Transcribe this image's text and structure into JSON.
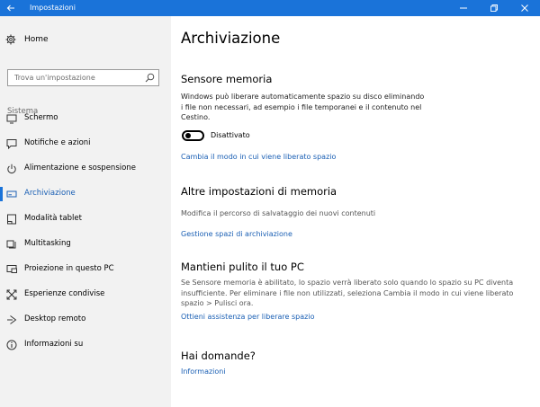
{
  "titlebar": {
    "title": "Impostazioni"
  },
  "sidebar": {
    "home_label": "Home",
    "search_placeholder": "Trova un'impostazione",
    "section_label": "Sistema",
    "items": [
      {
        "label": "Schermo",
        "icon": "monitor-icon"
      },
      {
        "label": "Notifiche e azioni",
        "icon": "notification-icon"
      },
      {
        "label": "Alimentazione e sospensione",
        "icon": "power-icon"
      },
      {
        "label": "Archiviazione",
        "icon": "storage-icon",
        "active": true
      },
      {
        "label": "Modalità tablet",
        "icon": "tablet-icon"
      },
      {
        "label": "Multitasking",
        "icon": "multitasking-icon"
      },
      {
        "label": "Proiezione in questo PC",
        "icon": "projection-icon"
      },
      {
        "label": "Esperienze condivise",
        "icon": "shared-experiences-icon"
      },
      {
        "label": "Desktop remoto",
        "icon": "remote-desktop-icon"
      },
      {
        "label": "Informazioni su",
        "icon": "info-icon"
      }
    ]
  },
  "main": {
    "title": "Archiviazione",
    "sensor": {
      "heading": "Sensore memoria",
      "description": "Windows può liberare automaticamente spazio su disco eliminando i file non necessari, ad esempio i file temporanei e il contenuto nel Cestino.",
      "toggle_label": "Disattivato",
      "toggle_on": false,
      "link": "Cambia il modo in cui viene liberato spazio"
    },
    "other": {
      "heading": "Altre impostazioni di memoria",
      "description": "Modifica il percorso di salvataggio dei nuovi contenuti",
      "link": "Gestione spazi di archiviazione"
    },
    "clean": {
      "heading": "Mantieni pulito il tuo PC",
      "description": "Se Sensore memoria è abilitato, lo spazio verrà liberato solo quando lo spazio su PC diventa insufficiente. Per eliminare i file non utilizzati, seleziona Cambia il modo in cui viene liberato spazio > Pulisci ora.",
      "link": "Ottieni assistenza per liberare spazio"
    },
    "questions": {
      "heading": "Hai domande?",
      "link": "Informazioni"
    }
  },
  "colors": {
    "accent": "#1a73d9",
    "link": "#1a5fb4",
    "sidebar_bg": "#f2f2f2"
  }
}
